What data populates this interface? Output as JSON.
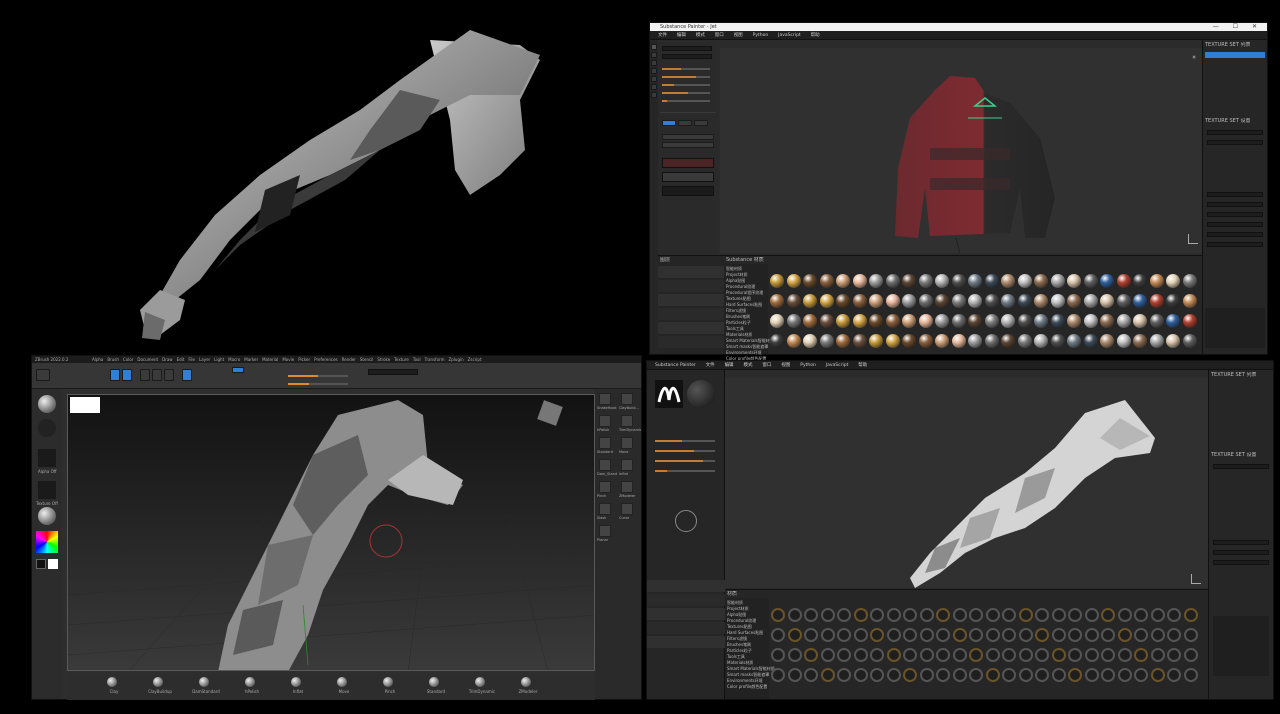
{
  "colors": {
    "bg": "#000000",
    "panel": "#2b2b2b",
    "accent_orange": "#c87a2f",
    "accent_blue": "#2f7fd6",
    "hoodie_red": "#7e2b31",
    "hoodie_dark": "#2c2b2b",
    "hoodie_logo": "#3bd08a"
  },
  "render_panel": {},
  "sp_top": {
    "window_title": "Substance Painter - Jet",
    "window_controls": "— ☐ ✕",
    "menu": [
      "文件",
      "编辑",
      "模式",
      "窗口",
      "视图",
      "Python",
      "JavaScript",
      "帮助"
    ],
    "shelf_title": "Substance 材质",
    "shelf_categories": [
      "智能材质",
      "Project材质",
      "Alpha贴图",
      "Procedural纹理",
      "Procedural程序纹理",
      "Textures贴图",
      "Hard Surfaces贴图",
      "Filters滤镜",
      "Brushes笔刷",
      "Particles粒子",
      "Tools工具",
      "Materials材质",
      "Smart Materials智能材质",
      "Smart masks智能遮罩",
      "Environments环境",
      "Color profile颜色配置"
    ],
    "ball_colors": [
      "#c89b3a",
      "#d4a545",
      "#6b4a2a",
      "#8a5f3c",
      "#cfa078",
      "#e8b79a",
      "#9c9c9c",
      "#6e6e6e",
      "#5b4534",
      "#7b7b7b",
      "#b5b5b5",
      "#4e4e4e",
      "#707c86",
      "#3c4a58",
      "#ad8a6c",
      "#c2c2c2",
      "#8c6b4f",
      "#a8a8a8",
      "#d9c3a9",
      "#5f5f5f",
      "#2f5f9c",
      "#b04030",
      "#3d3d3d",
      "#c48a55",
      "#e3d2b5",
      "#7a7a7a",
      "#a16c3d",
      "#6a4e3c"
    ],
    "ball_rows": 4,
    "layers_title": "图层",
    "right_title": "TEXTURE SET 列表",
    "right_props_title": "TEXTURE SET 设置"
  },
  "zbrush": {
    "title_bar": "ZBrush 2022.0.2",
    "menu": [
      "Alpha",
      "Brush",
      "Color",
      "Document",
      "Draw",
      "Edit",
      "File",
      "Layer",
      "Light",
      "Macro",
      "Marker",
      "Material",
      "Movie",
      "Picker",
      "Preferences",
      "Render",
      "Stencil",
      "Stroke",
      "Texture",
      "Tool",
      "Transform",
      "Zplugin",
      "Zscript"
    ],
    "right_labels": [
      "SnakeHook",
      "ClayBuild...",
      "hPolish",
      "TrimDynamic",
      "Standard",
      "Move",
      "Dam_Stand",
      "Inflat",
      "Pinch",
      "ZModeler",
      "Slash",
      "Curve",
      "Planar"
    ],
    "bottom_brushes": [
      "Clay",
      "ClayBuildup",
      "DamStandard",
      "hPolish",
      "Inflat",
      "Move",
      "Pinch",
      "Standard",
      "TrimDynamic",
      "ZModeler"
    ],
    "left_labels": [
      "Alpha Off",
      "Texture Off",
      "Material"
    ]
  },
  "sp_bottom": {
    "window_title": "Substance Painter",
    "menu": [
      "文件",
      "编辑",
      "模式",
      "窗口",
      "视图",
      "Python",
      "JavaScript",
      "帮助"
    ],
    "shelf_title": "材质",
    "shelf_categories": [
      "智能材质",
      "Project材质",
      "Alpha贴图",
      "Procedural纹理",
      "Textures贴图",
      "Hard Surfaces贴图",
      "Filters滤镜",
      "Brushes笔刷",
      "Particles粒子",
      "Tools工具",
      "Materials材质",
      "Smart Materials智能材质",
      "Smart masks智能遮罩",
      "Environments环境",
      "Color profile颜色配置"
    ],
    "ball_rows": 4,
    "right_title": "TEXTURE SET 列表",
    "right_props_title": "TEXTURE SET 设置",
    "layer_stack_title": "图层"
  }
}
